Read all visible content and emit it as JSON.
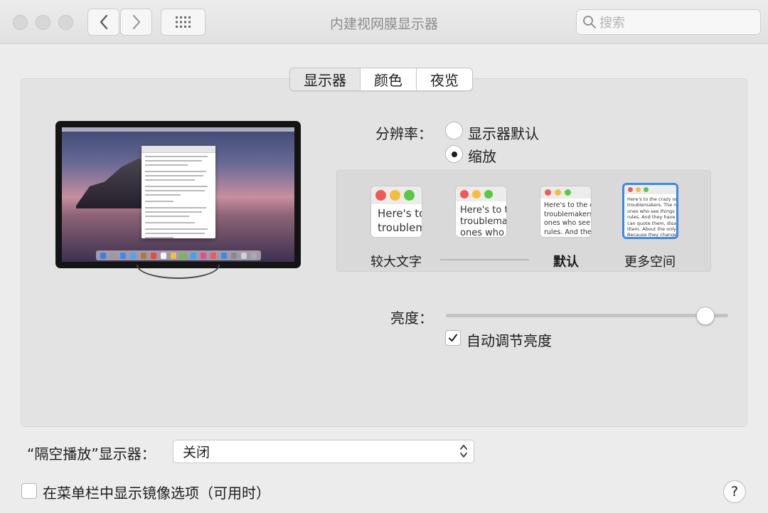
{
  "window": {
    "title": "内建视网膜显示器",
    "search_placeholder": "搜索"
  },
  "tabs": [
    {
      "label": "显示器",
      "selected": true
    },
    {
      "label": "颜色",
      "selected": false
    },
    {
      "label": "夜览",
      "selected": false
    }
  ],
  "resolution": {
    "label": "分辨率：",
    "options": [
      {
        "label": "显示器默认",
        "selected": false
      },
      {
        "label": "缩放",
        "selected": true
      }
    ]
  },
  "scaling": {
    "options": [
      {
        "preview_text": "Here's to\ntroublem",
        "label": "较大文字",
        "selected": false
      },
      {
        "preview_text": "Here's to t\ntroublema\nones who",
        "label": "",
        "selected": false
      },
      {
        "preview_text": "Here's to the cr\ntroublemakers.\nones who see t\nrules. And they",
        "label": "默认",
        "selected": false
      },
      {
        "preview_text": "Here's to the crazy one\ntroublemakers. The rou\nones who see things dif\nrules. And they have no\ncan quote them, disagre\nthem. About the only th\nBecause they change t",
        "label": "更多空间",
        "selected": true
      }
    ]
  },
  "brightness": {
    "label": "亮度：",
    "value": 0.92,
    "auto_label": "自动调节亮度",
    "auto_checked": true
  },
  "airplay": {
    "label": "“隔空播放”显示器：",
    "value": "关闭"
  },
  "mirror": {
    "label": "在菜单栏中显示镜像选项（可用时）",
    "checked": false
  },
  "help_label": "?",
  "colors": {
    "accent": "#3c8ae6",
    "traffic_red": "#ee5b56",
    "traffic_yellow": "#f4bd3e",
    "traffic_green": "#5bc746"
  }
}
